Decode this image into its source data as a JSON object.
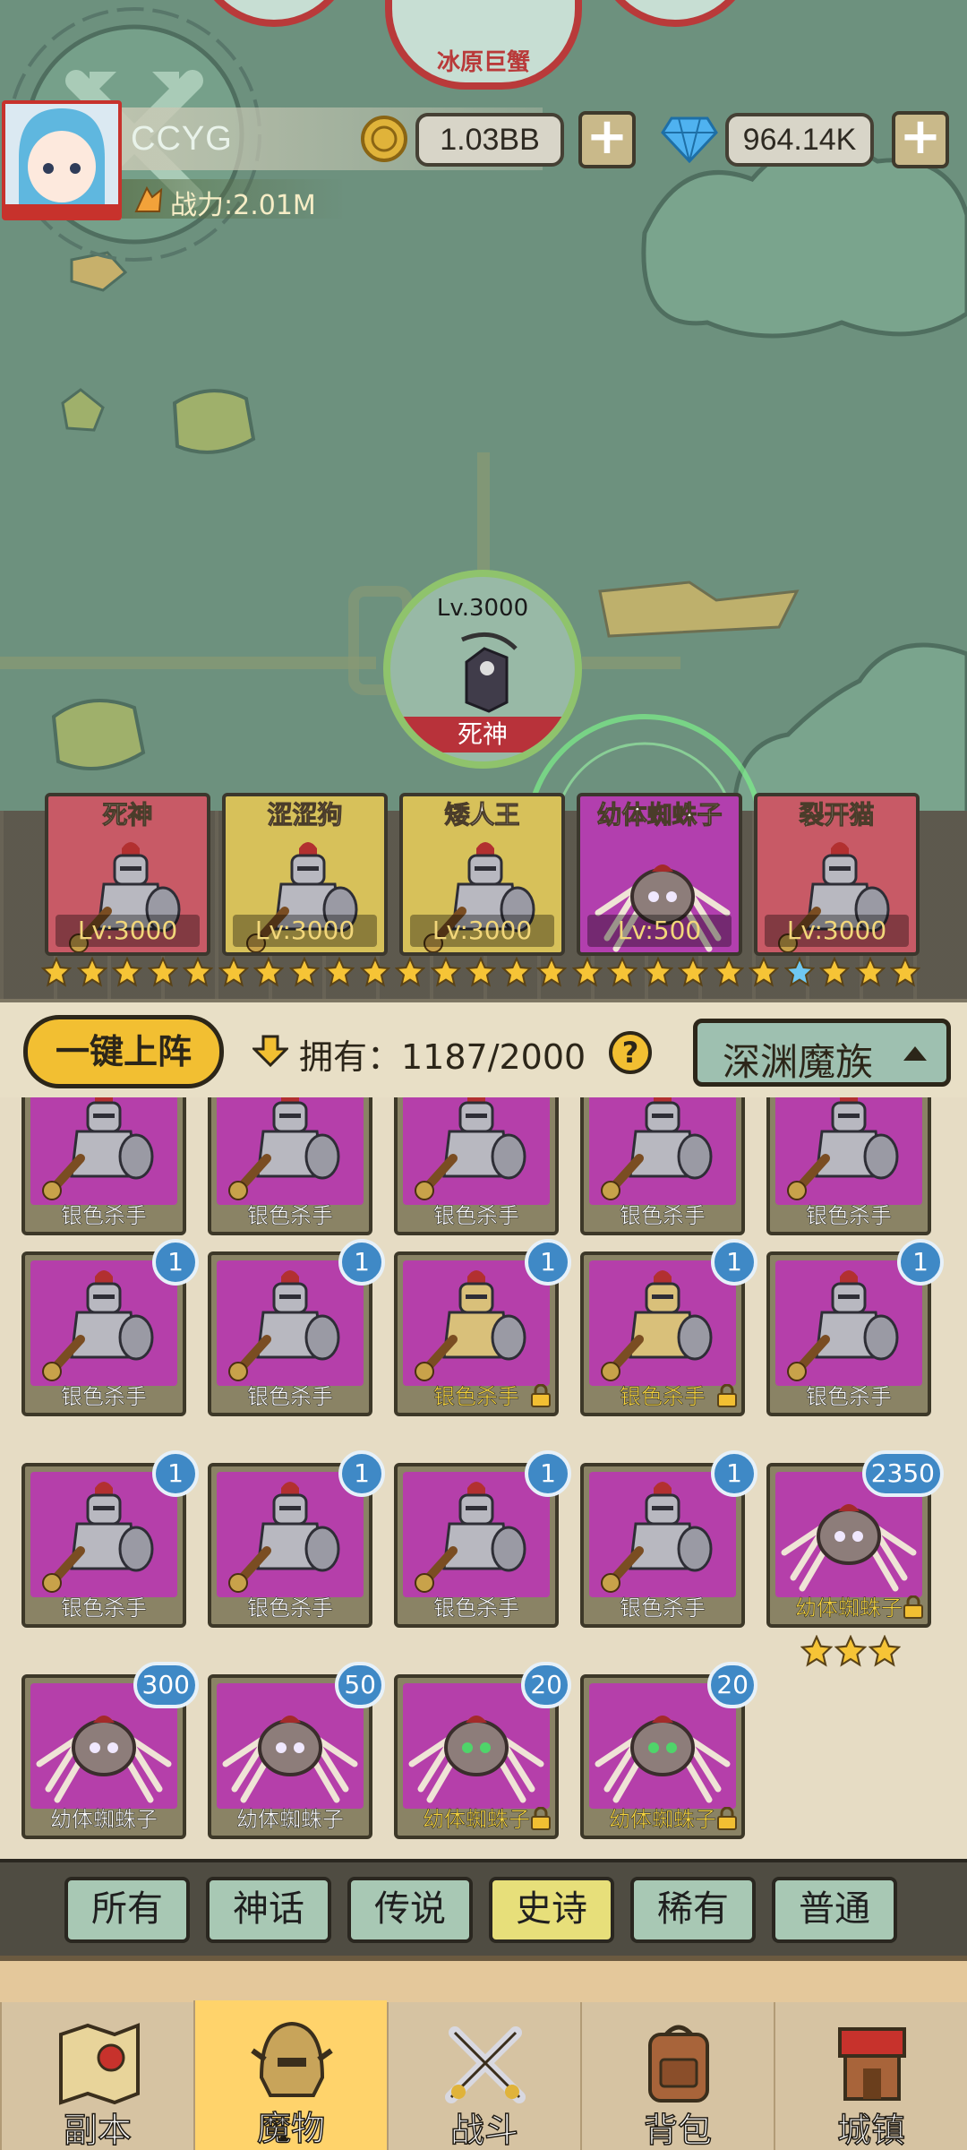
{
  "map": {
    "top_nodes": [
      "冰原巨蟹"
    ],
    "main_hero": {
      "level": "Lv.3000",
      "name": "死神"
    }
  },
  "player": {
    "name": "CCYG",
    "coins": "1.03BB",
    "gems": "964.14K",
    "power": "战力:2.01M",
    "coin_icon": "gold-coin-icon",
    "gem_icon": "diamond-icon"
  },
  "lineup": [
    {
      "name": "死神",
      "level": "Lv:3000",
      "color": "#c85a66"
    },
    {
      "name": "涩涩狗",
      "level": "Lv:3000",
      "color": "#d7c15a"
    },
    {
      "name": "矮人王",
      "level": "Lv:3000",
      "color": "#d7c15a"
    },
    {
      "name": "幼体蜘蛛子",
      "level": "Lv:500",
      "color": "#b23fae"
    },
    {
      "name": "裂开猫",
      "level": "Lv:3000",
      "color": "#c85a66"
    }
  ],
  "filter": {
    "auto_deploy": "一键上阵",
    "owned": "拥有：1187/2000",
    "help": "?",
    "faction": "深渊魔族"
  },
  "monsters": [
    {
      "name": "银色杀手",
      "badge": "",
      "locked": false,
      "gold": false,
      "kind": "knight"
    },
    {
      "name": "银色杀手",
      "badge": "",
      "locked": false,
      "gold": false,
      "kind": "knight"
    },
    {
      "name": "银色杀手",
      "badge": "",
      "locked": false,
      "gold": false,
      "kind": "knight"
    },
    {
      "name": "银色杀手",
      "badge": "",
      "locked": false,
      "gold": false,
      "kind": "knight"
    },
    {
      "name": "银色杀手",
      "badge": "",
      "locked": false,
      "gold": false,
      "kind": "knight"
    },
    {
      "name": "银色杀手",
      "badge": "1",
      "locked": false,
      "gold": false,
      "kind": "knight"
    },
    {
      "name": "银色杀手",
      "badge": "1",
      "locked": false,
      "gold": false,
      "kind": "knight"
    },
    {
      "name": "银色杀手",
      "badge": "1",
      "locked": true,
      "gold": true,
      "kind": "knight-gold"
    },
    {
      "name": "银色杀手",
      "badge": "1",
      "locked": true,
      "gold": true,
      "kind": "knight-gold"
    },
    {
      "name": "银色杀手",
      "badge": "1",
      "locked": false,
      "gold": false,
      "kind": "knight"
    },
    {
      "name": "银色杀手",
      "badge": "1",
      "locked": false,
      "gold": false,
      "kind": "knight"
    },
    {
      "name": "银色杀手",
      "badge": "1",
      "locked": false,
      "gold": false,
      "kind": "knight"
    },
    {
      "name": "银色杀手",
      "badge": "1",
      "locked": false,
      "gold": false,
      "kind": "knight"
    },
    {
      "name": "银色杀手",
      "badge": "1",
      "locked": false,
      "gold": false,
      "kind": "knight"
    },
    {
      "name": "幼体蜘蛛子",
      "badge": "2350",
      "locked": true,
      "gold": true,
      "kind": "spider",
      "stars": 3
    },
    {
      "name": "幼体蜘蛛子",
      "badge": "300",
      "locked": false,
      "gold": false,
      "kind": "spider"
    },
    {
      "name": "幼体蜘蛛子",
      "badge": "50",
      "locked": false,
      "gold": false,
      "kind": "spider"
    },
    {
      "name": "幼体蜘蛛子",
      "badge": "20",
      "locked": true,
      "gold": true,
      "kind": "spider-green"
    },
    {
      "name": "幼体蜘蛛子",
      "badge": "20",
      "locked": true,
      "gold": true,
      "kind": "spider-green"
    }
  ],
  "rarity_tabs": [
    {
      "label": "所有",
      "active": false
    },
    {
      "label": "神话",
      "active": false
    },
    {
      "label": "传说",
      "active": false
    },
    {
      "label": "史诗",
      "active": true
    },
    {
      "label": "稀有",
      "active": false
    },
    {
      "label": "普通",
      "active": false
    }
  ],
  "nav": [
    {
      "label": "副本",
      "icon": "map-icon",
      "active": false
    },
    {
      "label": "魔物",
      "icon": "helmet-icon",
      "active": true
    },
    {
      "label": "战斗",
      "icon": "crossed-swords-icon",
      "active": false
    },
    {
      "label": "背包",
      "icon": "backpack-icon",
      "active": false
    },
    {
      "label": "城镇",
      "icon": "shop-icon",
      "active": false
    }
  ],
  "colors": {
    "accent": "#f2bf32",
    "epic": "#b53faa",
    "badge": "#3f89c6",
    "active_tab": "#e7df7a"
  }
}
